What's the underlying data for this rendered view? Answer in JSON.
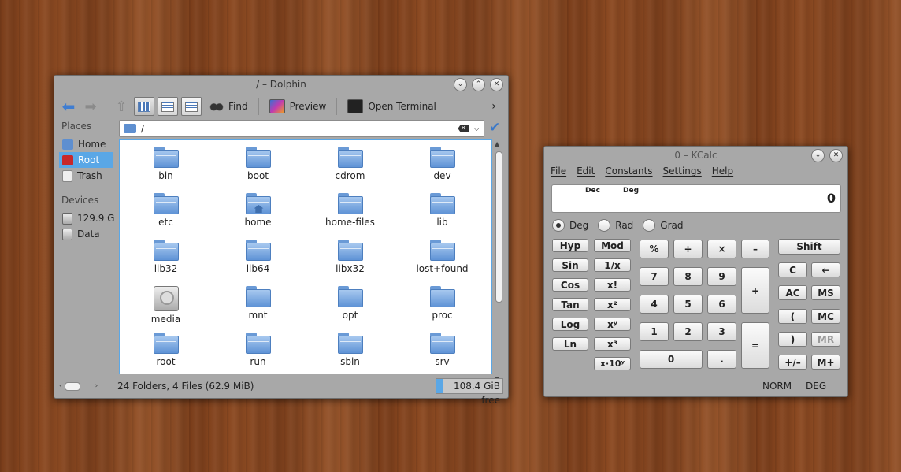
{
  "dolphin": {
    "title": "/ – Dolphin",
    "toolbar": {
      "find": "Find",
      "preview": "Preview",
      "open_terminal": "Open Terminal",
      "more": "›"
    },
    "places": {
      "header": "Places",
      "items": [
        {
          "label": "Home",
          "icon": "home-folder-icon",
          "color": "#5e8fd0"
        },
        {
          "label": "Root",
          "icon": "root-folder-icon",
          "color": "#c8282a"
        },
        {
          "label": "Trash",
          "icon": "trash-icon",
          "color": "#e8e8e8"
        }
      ],
      "devices_header": "Devices",
      "devices": [
        {
          "label": "129.9 G",
          "icon": "hard-drive-icon"
        },
        {
          "label": "Data",
          "icon": "hard-drive-icon"
        }
      ]
    },
    "address": {
      "value": "/"
    },
    "files": [
      {
        "name": "bin",
        "type": "folder"
      },
      {
        "name": "boot",
        "type": "folder"
      },
      {
        "name": "cdrom",
        "type": "folder"
      },
      {
        "name": "dev",
        "type": "folder"
      },
      {
        "name": "etc",
        "type": "folder"
      },
      {
        "name": "home",
        "type": "home-folder"
      },
      {
        "name": "home-files",
        "type": "folder"
      },
      {
        "name": "lib",
        "type": "folder"
      },
      {
        "name": "lib32",
        "type": "folder"
      },
      {
        "name": "lib64",
        "type": "folder"
      },
      {
        "name": "libx32",
        "type": "folder"
      },
      {
        "name": "lost+found",
        "type": "folder"
      },
      {
        "name": "media",
        "type": "drive"
      },
      {
        "name": "mnt",
        "type": "folder"
      },
      {
        "name": "opt",
        "type": "folder"
      },
      {
        "name": "proc",
        "type": "folder"
      },
      {
        "name": "root",
        "type": "folder"
      },
      {
        "name": "run",
        "type": "folder"
      },
      {
        "name": "sbin",
        "type": "folder"
      },
      {
        "name": "srv",
        "type": "folder"
      }
    ],
    "status": {
      "summary": "24 Folders, 4 Files (62.9 MiB)",
      "free_space": "108.4 GiB free",
      "used_fraction": 0.09
    },
    "accent": "#5aa7e6"
  },
  "kcalc": {
    "title": "0 – KCalc",
    "menu": [
      "File",
      "Edit",
      "Constants",
      "Settings",
      "Help"
    ],
    "display": {
      "base": "Dec",
      "angle": "Deg",
      "value": "0"
    },
    "angle_modes": [
      {
        "label": "Deg",
        "selected": true
      },
      {
        "label": "Rad",
        "selected": false
      },
      {
        "label": "Grad",
        "selected": false
      }
    ],
    "fn_left": [
      "Hyp",
      "Sin",
      "Cos",
      "Tan",
      "Log",
      "Ln"
    ],
    "fn_right": [
      "Mod",
      "1/x",
      "x!",
      "x²",
      "xʸ",
      "x³",
      "x·10ʸ"
    ],
    "num": {
      "percent": "%",
      "divide": "÷",
      "multiply": "×",
      "minus": "–",
      "seven": "7",
      "eight": "8",
      "nine": "9",
      "plus": "+",
      "four": "4",
      "five": "5",
      "six": "6",
      "one": "1",
      "two": "2",
      "three": "3",
      "equals": "=",
      "zero": "0",
      "dot": "."
    },
    "mem": {
      "shift": "Shift",
      "clear": "C",
      "backspace": "←",
      "all_clear": "AC",
      "ms": "MS",
      "open_paren": "(",
      "mc": "MC",
      "close_paren": ")",
      "mr": "MR",
      "sign": "+/–",
      "mplus": "M+"
    },
    "status": {
      "mode": "NORM",
      "angle": "DEG"
    }
  }
}
